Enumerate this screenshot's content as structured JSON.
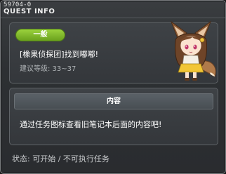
{
  "window": {
    "quest_id": "59704-0",
    "title": "QUEST INFO"
  },
  "quest": {
    "category": "一般",
    "name": "[橡果侦探团]找到嘟嘟!",
    "level": "建议等级: 33~37",
    "npc_icon": "fox-eared-girl-npc"
  },
  "content": {
    "header": "内容",
    "text": "通过任务图标查看旧笔记本后面的内容吧!"
  },
  "status": {
    "text": "状态: 可开始 / 不可执行任务"
  },
  "colors": {
    "badge": "#86c12b",
    "panel": "#3a3e42",
    "background": "#2d3033"
  }
}
